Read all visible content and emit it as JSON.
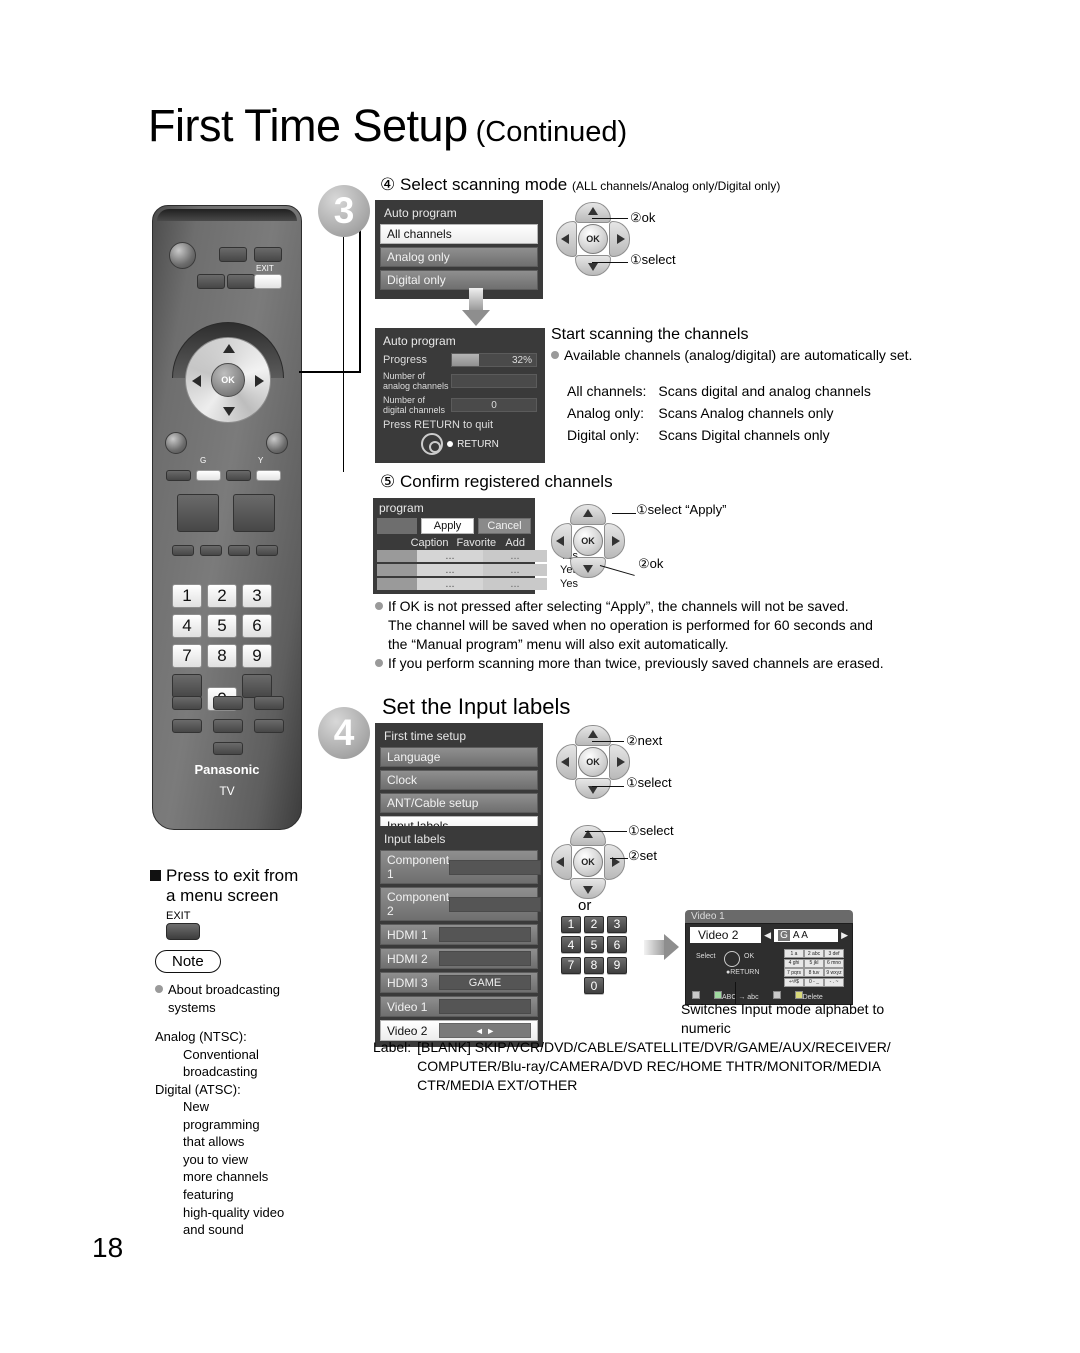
{
  "page": {
    "title_main": "First Time Setup",
    "title_sub": "(Continued)",
    "number": "18"
  },
  "remote": {
    "exit_label": "EXIT",
    "ok_label": "OK",
    "color_g": "G",
    "color_y": "Y",
    "brand": "Panasonic",
    "brand_sub": "TV",
    "keys": [
      "1",
      "2",
      "3",
      "4",
      "5",
      "6",
      "7",
      "8",
      "9",
      "0"
    ]
  },
  "step3": {
    "number": "3",
    "item4_num": "④",
    "item4_title": "Select scanning mode",
    "item4_note": "(ALL channels/Analog only/Digital only)",
    "menu": {
      "title": "Auto program",
      "items": [
        {
          "label": "All channels",
          "selected": true
        },
        {
          "label": "Analog only",
          "selected": false
        },
        {
          "label": "Digital only",
          "selected": false
        }
      ]
    },
    "pad_callouts": {
      "ok": "②ok",
      "select": "①select",
      "ok_text": "OK"
    },
    "progress_screen": {
      "title": "Auto program",
      "progress_label": "Progress",
      "progress_value": "32%",
      "progress_percent": 32,
      "analog_label": "Number of analog channels",
      "analog_value": "",
      "digital_label": "Number of digital channels",
      "digital_value": "0",
      "quit_text": "Press RETURN to quit",
      "return_label": "RETURN"
    },
    "scanning": {
      "heading": "Start scanning the channels",
      "bullet": "Available channels (analog/digital) are automatically set.",
      "modes": [
        {
          "name": "All channels:",
          "desc": "Scans digital and analog channels"
        },
        {
          "name": "Analog only:",
          "desc": "Scans Analog channels only"
        },
        {
          "name": "Digital only:",
          "desc": "Scans Digital channels only"
        }
      ]
    },
    "item5_num": "⑤",
    "item5_title": "Confirm registered channels",
    "channel_table": {
      "title": "program",
      "apply_label": "Apply",
      "cancel_label": "Cancel",
      "headers": [
        "Caption",
        "Favorite",
        "Add"
      ],
      "rows": [
        [
          "...",
          "...",
          "Yes"
        ],
        [
          "...",
          "...",
          "Yes"
        ],
        [
          "...",
          "...",
          "Yes"
        ]
      ]
    },
    "confirm_callouts": {
      "select": "①select “Apply”",
      "ok": "②ok",
      "ok_text": "OK"
    },
    "notes": [
      "If OK is not pressed after selecting “Apply”, the channels will not be saved.",
      "The channel will be saved when no operation is performed for 60 seconds and",
      "the “Manual program” menu will also exit automatically.",
      "If you perform scanning more than twice, previously saved channels are erased."
    ]
  },
  "step4": {
    "number": "4",
    "heading": "Set the Input labels",
    "first_time_setup": {
      "title": "First time setup",
      "items": [
        {
          "label": "Language",
          "selected": false
        },
        {
          "label": "Clock",
          "selected": false
        },
        {
          "label": "ANT/Cable setup",
          "selected": false
        },
        {
          "label": "Input labels",
          "selected": true
        }
      ]
    },
    "fts_callouts": {
      "next": "②next",
      "select": "①select",
      "ok_text": "OK"
    },
    "input_labels": {
      "title": "Input labels",
      "items": [
        {
          "label": "Component 1",
          "value": "",
          "selected": false
        },
        {
          "label": "Component 2",
          "value": "",
          "selected": false
        },
        {
          "label": "HDMI 1",
          "value": "",
          "selected": false
        },
        {
          "label": "HDMI 2",
          "value": "",
          "selected": false
        },
        {
          "label": "HDMI 3",
          "value": "GAME",
          "selected": false
        },
        {
          "label": "Video 1",
          "value": "",
          "selected": false
        },
        {
          "label": "Video 2",
          "value": "◄                ►",
          "selected": true
        }
      ]
    },
    "il_callouts": {
      "select": "①select",
      "set": "②set",
      "or": "or",
      "ok_text": "OK",
      "keys": [
        "1",
        "2",
        "3",
        "4",
        "5",
        "6",
        "7",
        "8",
        "9",
        "0"
      ]
    },
    "video_detail": {
      "bg_title": "Video 1",
      "name": "Video 2",
      "edit_prefix": "G",
      "edit_chars": "A A",
      "select_label": "Select",
      "ok_label": "OK",
      "return_label": "RETURN",
      "abc_label": "ABC → abc",
      "delete_label": "Delete",
      "keypad": [
        "1 a",
        "2 abc",
        "3 def",
        "4 ghi",
        "5 jkl",
        "6 mno",
        "7 pqrs",
        "8 tuv",
        "9 wxyz",
        "↵#$",
        "0 - _",
        "- . ~"
      ]
    },
    "caption": "Switches Input mode alphabet to numeric",
    "label_intro": "Label:",
    "label_lines": [
      "[BLANK] SKIP/VCR/DVD/CABLE/SATELLITE/DVR/GAME/AUX/RECEIVER/",
      "COMPUTER/Blu-ray/CAMERA/DVD REC/HOME THTR/MONITOR/MEDIA",
      "CTR/MEDIA EXT/OTHER"
    ]
  },
  "left_notes": {
    "exit_heading_line1": "Press to exit from",
    "exit_heading_line2": "a menu screen",
    "exit_key_label": "EXIT",
    "note_label": "Note",
    "bullet_line1": "About broadcasting",
    "bullet_line2": "systems",
    "analog_head": "Analog (NTSC):",
    "analog_body": [
      "Conventional",
      "broadcasting"
    ],
    "digital_head": "Digital (ATSC):",
    "digital_body": [
      "New",
      "programming",
      "that allows",
      "you to view",
      "more channels",
      "featuring",
      "high-quality video",
      "and sound"
    ]
  }
}
